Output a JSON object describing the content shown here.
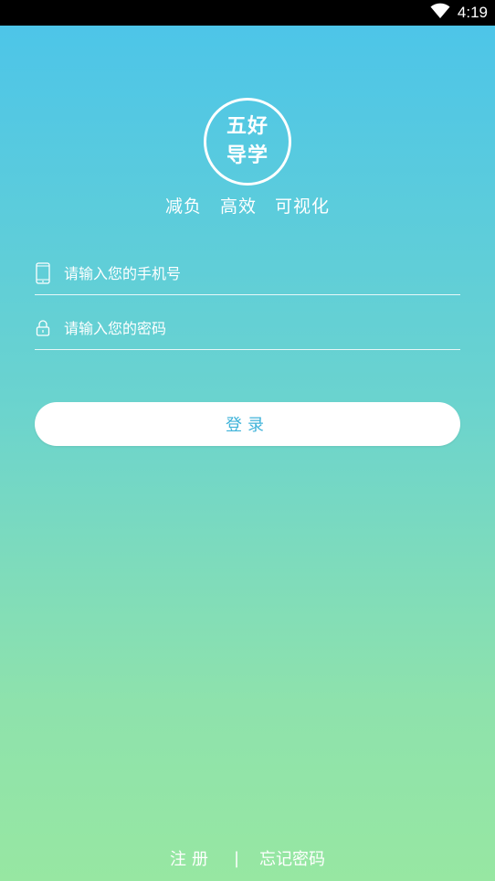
{
  "status_bar": {
    "time": "4:19",
    "wifi_icon": "wifi-icon",
    "battery_icon": "battery-icon"
  },
  "logo": {
    "line1": "五好",
    "line2": "导学"
  },
  "tagline": [
    "减负",
    "高效",
    "可视化"
  ],
  "form": {
    "phone_placeholder": "请输入您的手机号",
    "password_placeholder": "请输入您的密码",
    "phone_icon": "phone-icon",
    "lock_icon": "lock-icon"
  },
  "login_button": "登录",
  "footer": {
    "register": "注册",
    "separator": "|",
    "forgot_password": "忘记密码"
  },
  "colors": {
    "gradient_top": "#4bc4ea",
    "gradient_bottom": "#97e7a2",
    "button_text": "#3fb3d9"
  }
}
